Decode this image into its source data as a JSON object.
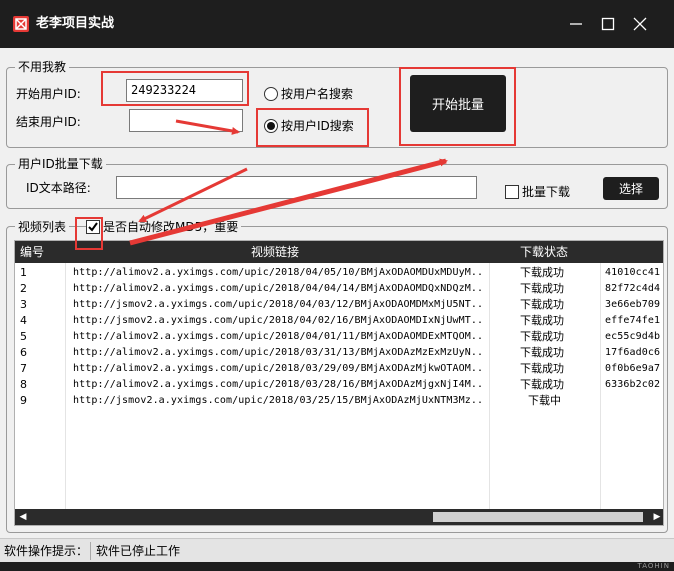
{
  "window": {
    "title": "老李项目实战",
    "minimize_glyph": "─",
    "maximize_glyph": "☐",
    "close_glyph": "✕"
  },
  "group_id_range": {
    "title": "不用我教",
    "start_label": "开始用户ID:",
    "start_value": "249233224",
    "end_label": "结束用户ID:",
    "end_value": "",
    "radio_username": "按用户名搜索",
    "radio_userid": "按用户ID搜索",
    "selected": "userid",
    "start_button": "开始批量"
  },
  "group_batch": {
    "title": "用户ID批量下载",
    "path_label": "ID文本路径:",
    "path_value": "",
    "batch_checkbox": "批量下载",
    "batch_checked": false,
    "choose_button": "选择"
  },
  "video_list": {
    "title": "视频列表",
    "md5_checkbox": "是否自动修改MD5，重要",
    "md5_checked": true,
    "headers": [
      "编号",
      "视频链接",
      "下载状态",
      ""
    ],
    "rows": [
      {
        "no": "1",
        "url": "http://alimov2.a.yximgs.com/upic/2018/04/05/10/BMjAxODAOMDUxMDUyM...",
        "status": "下载成功",
        "hash": "41010cc41"
      },
      {
        "no": "2",
        "url": "http://alimov2.a.yximgs.com/upic/2018/04/04/14/BMjAxODAOMDQxNDQzM...",
        "status": "下载成功",
        "hash": "82f72c4d4"
      },
      {
        "no": "3",
        "url": "http://jsmov2.a.yximgs.com/upic/2018/04/03/12/BMjAxODAOMDMxMjU5NT...",
        "status": "下载成功",
        "hash": "3e66eb709"
      },
      {
        "no": "4",
        "url": "http://jsmov2.a.yximgs.com/upic/2018/04/02/16/BMjAxODAOMDIxNjUwMT...",
        "status": "下载成功",
        "hash": "effe74fe1"
      },
      {
        "no": "5",
        "url": "http://alimov2.a.yximgs.com/upic/2018/04/01/11/BMjAxODAOMDExMTQOM...",
        "status": "下载成功",
        "hash": "ec55c9d4b"
      },
      {
        "no": "6",
        "url": "http://alimov2.a.yximgs.com/upic/2018/03/31/13/BMjAxODAzMzExMzUyN...",
        "status": "下载成功",
        "hash": "17f6ad0c6"
      },
      {
        "no": "7",
        "url": "http://alimov2.a.yximgs.com/upic/2018/03/29/09/BMjAxODAzMjkwOTAOM...",
        "status": "下载成功",
        "hash": "0f0b6e9a7"
      },
      {
        "no": "8",
        "url": "http://alimov2.a.yximgs.com/upic/2018/03/28/16/BMjAxODAzMjgxNjI4M...",
        "status": "下载成功",
        "hash": "6336b2c02"
      },
      {
        "no": "9",
        "url": "http://jsmov2.a.yximgs.com/upic/2018/03/25/15/BMjAxODAzMjUxNTM3Mz...",
        "status": "下载中",
        "hash": ""
      }
    ]
  },
  "statusbar": {
    "label": "软件操作提示：",
    "message": "软件已停止工作"
  },
  "watermark": "TAOHIN",
  "colors": {
    "titlebar": "#1e1e1e",
    "accent_red": "#e53935",
    "window_bg": "#f0f0f0"
  },
  "icons": [
    "app-logo-icon",
    "minimize-icon",
    "maximize-icon",
    "close-icon",
    "check-icon",
    "scroll-left-icon",
    "scroll-right-icon"
  ]
}
